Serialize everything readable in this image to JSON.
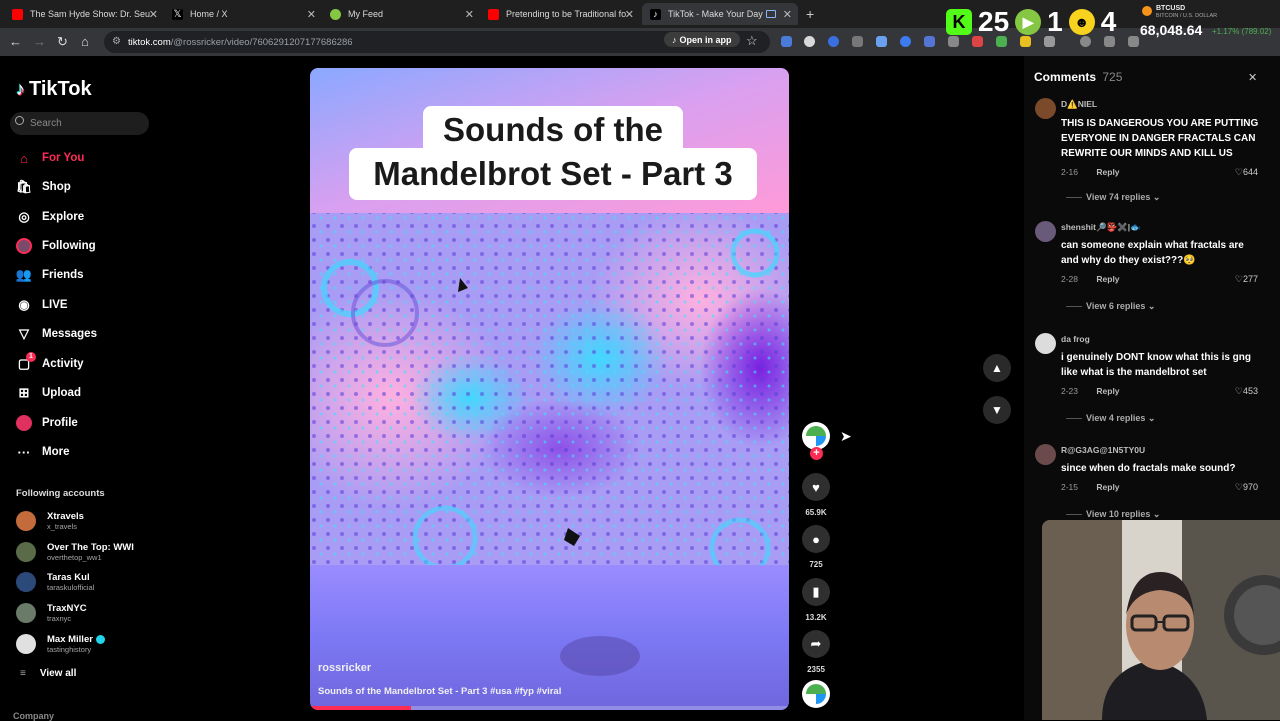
{
  "browser": {
    "tabs": [
      {
        "title": "The Sam Hyde Show: Dr. Seuss",
        "favicon": "youtube-icon",
        "color": "#ff0000"
      },
      {
        "title": "Home / X",
        "favicon": "x-icon",
        "color": "#000000"
      },
      {
        "title": "My Feed",
        "favicon": "rumble-icon",
        "color": "#85c742"
      },
      {
        "title": "Pretending to be Traditional fo",
        "favicon": "youtube-icon",
        "color": "#ff0000"
      },
      {
        "title": "TikTok - Make Your Day",
        "favicon": "tiktok-icon",
        "color": "#ffffff"
      }
    ],
    "url_host": "tiktok.com",
    "url_path": "/@rossricker/video/7606291207177686286",
    "open_in_app": "Open in app"
  },
  "overlay": {
    "counters": [
      {
        "icon": "kick-icon",
        "value": "25",
        "color": "#53fc18"
      },
      {
        "icon": "rumble-icon",
        "value": "1",
        "color": "#85c742"
      },
      {
        "icon": "smiley-glasses-icon",
        "value": "4",
        "color": "#f7d21e"
      }
    ],
    "ticker": {
      "symbol": "BTCUSD",
      "name": "BITCOIN / U.S. DOLLAR",
      "price": "68,048.64",
      "change": "+1.17% (789.02)"
    }
  },
  "sidebar": {
    "brand": "TikTok",
    "search_placeholder": "Search",
    "nav": [
      {
        "label": "For You",
        "icon": "home-icon",
        "active": true
      },
      {
        "label": "Shop",
        "icon": "shop-icon"
      },
      {
        "label": "Explore",
        "icon": "compass-icon"
      },
      {
        "label": "Following",
        "icon": "following-avatar-icon"
      },
      {
        "label": "Friends",
        "icon": "friends-icon"
      },
      {
        "label": "LIVE",
        "icon": "live-icon"
      },
      {
        "label": "Messages",
        "icon": "messages-icon"
      },
      {
        "label": "Activity",
        "icon": "activity-icon",
        "badge": "1"
      },
      {
        "label": "Upload",
        "icon": "upload-icon"
      },
      {
        "label": "Profile",
        "icon": "profile-avatar-icon"
      },
      {
        "label": "More",
        "icon": "more-icon"
      }
    ],
    "following_title": "Following accounts",
    "accounts": [
      {
        "name": "Xtravels",
        "handle": "x_travels",
        "color": "#c46b3c"
      },
      {
        "name": "Over The Top: WWI",
        "handle": "overthetop_ww1",
        "color": "#5a6b4a"
      },
      {
        "name": "Taras Kul",
        "handle": "taraskulofficial",
        "color": "#2b4a7a"
      },
      {
        "name": "TraxNYC",
        "handle": "traxnyc",
        "color": "#6a7b6a"
      },
      {
        "name": "Max Miller",
        "handle": "tastinghistory",
        "color": "#e0e0e0",
        "verified": true
      }
    ],
    "view_all": "View all",
    "footer": "Company"
  },
  "video": {
    "title_line1": "Sounds of the",
    "title_line2": "Mandelbrot Set - Part 3",
    "author": "rossricker",
    "caption": "Sounds of the Mandelbrot Set - Part 3 #usa #fyp #viral",
    "progress": 0.21
  },
  "actions": {
    "likes": "65.9K",
    "comments": "725",
    "saves": "13.2K",
    "shares": "2355"
  },
  "comments": {
    "title": "Comments",
    "count": "725",
    "items": [
      {
        "user": "D⚠️NIEL",
        "text": "THIS IS DANGEROUS YOU ARE PUTTING EVERYONE IN DANGER FRACTALS CAN REWRITE OUR MINDS AND KILL US",
        "date": "2-16",
        "reply": "Reply",
        "likes": "644",
        "replies": "View 74 replies",
        "color": "#7a4a2a"
      },
      {
        "user": "shenshit🔎👺✖️|🐟",
        "text": "can someone explain what fractals are and why do they exist???🥺",
        "date": "2-28",
        "reply": "Reply",
        "likes": "277",
        "replies": "View 6 replies",
        "color": "#6a5a7a"
      },
      {
        "user": "da frog",
        "text": "i genuinely DONT know what this is gng like what is the mandelbrot set",
        "date": "2-23",
        "reply": "Reply",
        "likes": "453",
        "replies": "View 4 replies",
        "color": "#dcdcdc"
      },
      {
        "user": "R@G3AG@1N5TY0U",
        "text": "since when do fractals make sound?",
        "date": "2-15",
        "reply": "Reply",
        "likes": "970",
        "replies": "View 10 replies",
        "color": "#6a4a4a"
      }
    ]
  }
}
